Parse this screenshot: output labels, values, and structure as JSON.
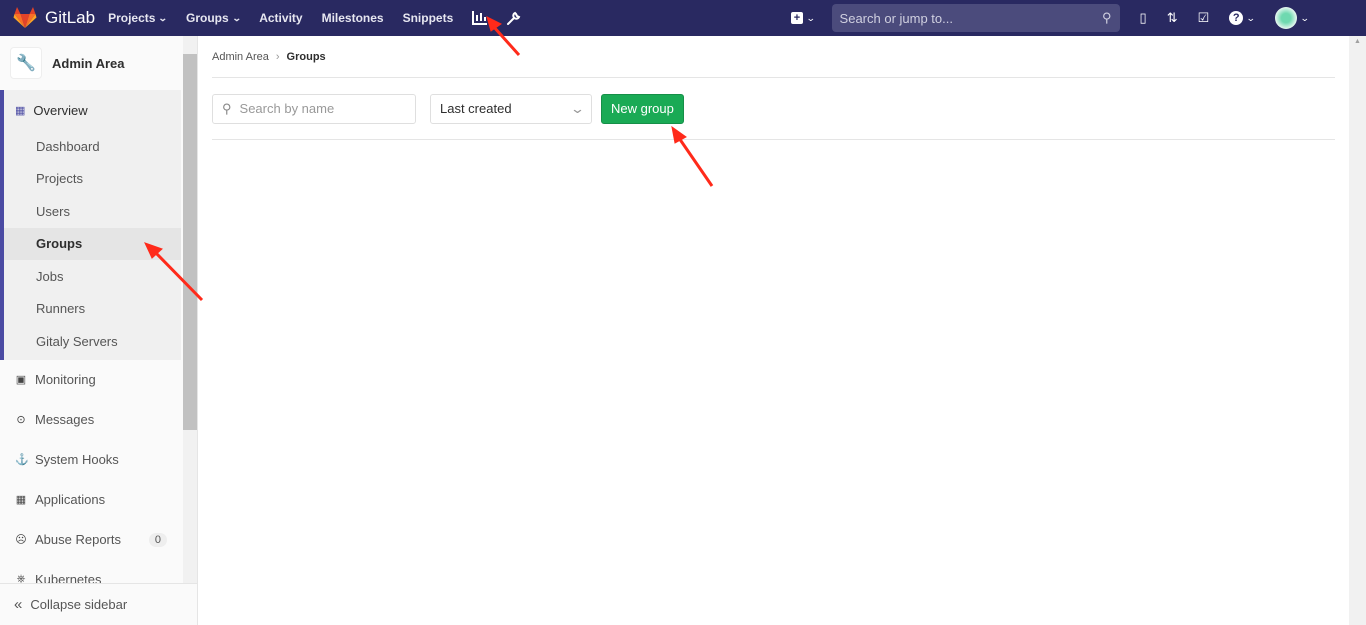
{
  "topbar": {
    "brand": "GitLab",
    "nav": [
      {
        "label": "Projects",
        "dropdown": true
      },
      {
        "label": "Groups",
        "dropdown": true
      },
      {
        "label": "Activity"
      },
      {
        "label": "Milestones"
      },
      {
        "label": "Snippets"
      }
    ],
    "search_placeholder": "Search or jump to...",
    "icons": [
      "chart-icon",
      "wrench-icon",
      "plus-square-icon",
      "search-icon",
      "issues-icon",
      "merge-request-icon",
      "todo-icon",
      "help-icon",
      "avatar"
    ]
  },
  "sidebar": {
    "title": "Admin Area",
    "overview": "Overview",
    "sub_items": [
      "Dashboard",
      "Projects",
      "Users",
      "Groups",
      "Jobs",
      "Runners",
      "Gitaly Servers"
    ],
    "active": "Groups",
    "items": [
      {
        "label": "Monitoring",
        "icon": "monitor-icon"
      },
      {
        "label": "Messages",
        "icon": "broadcast-icon"
      },
      {
        "label": "System Hooks",
        "icon": "hook-icon"
      },
      {
        "label": "Applications",
        "icon": "grid-icon"
      },
      {
        "label": "Abuse Reports",
        "icon": "frown-icon",
        "badge": "0"
      },
      {
        "label": "Kubernetes",
        "icon": "kubernetes-icon"
      }
    ],
    "collapse": "Collapse sidebar"
  },
  "breadcrumb": [
    "Admin Area",
    "Groups"
  ],
  "filters": {
    "search_placeholder": "Search by name",
    "sort": "Last created",
    "new_group": "New group"
  },
  "colors": {
    "topbar": "#292961",
    "primary_button": "#1aaa55",
    "annotation": "#ff2a1a"
  }
}
